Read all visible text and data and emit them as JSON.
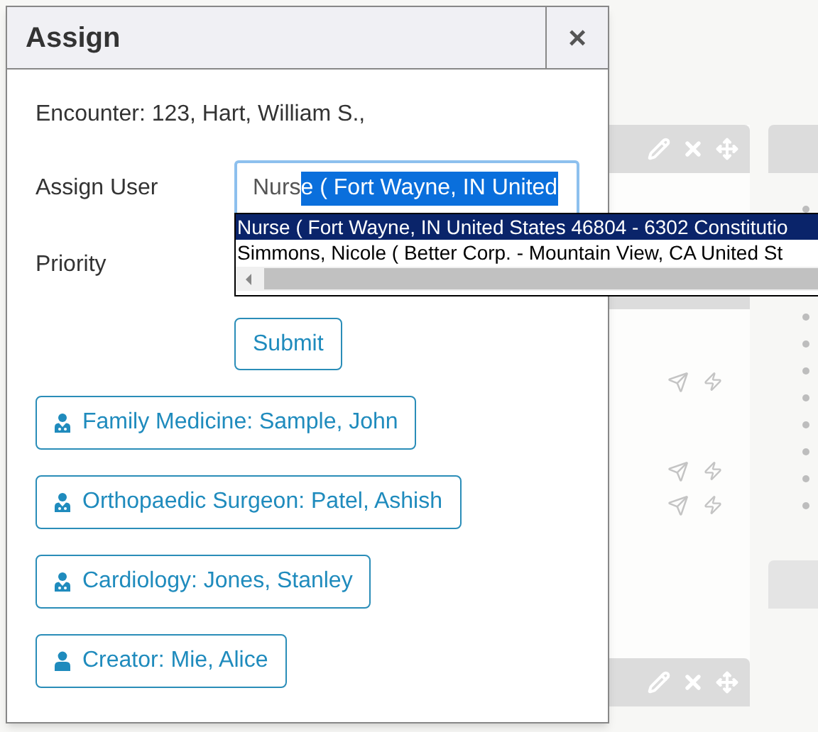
{
  "dialog": {
    "title": "Assign",
    "close": "×",
    "encounter": "Encounter: 123, Hart, William S.,",
    "assign_user": {
      "label": "Assign User",
      "typed": "Nurs",
      "completion": "e ( Fort Wayne, IN United"
    },
    "suggestions": [
      {
        "text": "Nurse ( Fort Wayne, IN United States 46804 - 6302 Constitutio",
        "selected": true
      },
      {
        "text": "Simmons, Nicole ( Better Corp. - Mountain View, CA United St",
        "selected": false
      }
    ],
    "priority": {
      "label": "Priority"
    },
    "submit": "Submit",
    "assignees": [
      {
        "kind": "doctor",
        "label": "Family Medicine: Sample, John"
      },
      {
        "kind": "doctor",
        "label": "Orthopaedic Surgeon: Patel, Ashish"
      },
      {
        "kind": "doctor",
        "label": "Cardiology: Jones, Stanley"
      },
      {
        "kind": "user",
        "label": "Creator: Mie, Alice"
      }
    ]
  }
}
